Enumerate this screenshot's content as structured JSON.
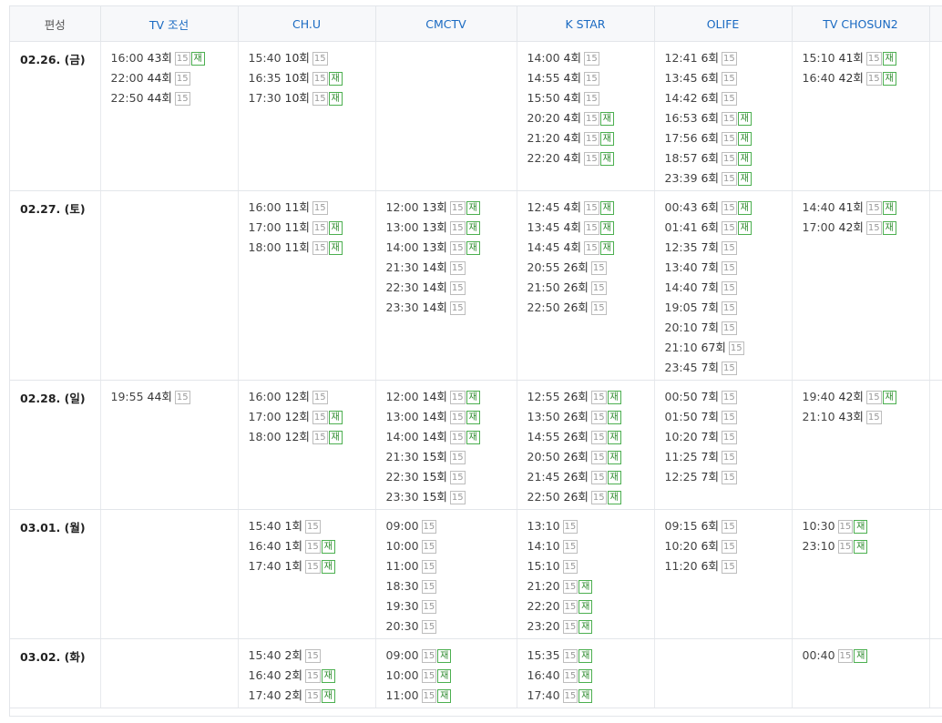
{
  "header": {
    "corner": "편성",
    "channels": [
      "TV 조선",
      "CH.U",
      "CMCTV",
      "K STAR",
      "OLIFE",
      "TV CHOSUN2"
    ]
  },
  "rows": [
    {
      "date": "02.26. (금)",
      "cells": [
        [
          {
            "t": "16:00",
            "ep": "43회",
            "g": "15",
            "re": "재"
          },
          {
            "t": "22:00",
            "ep": "44회",
            "g": "15"
          },
          {
            "t": "22:50",
            "ep": "44회",
            "g": "15"
          }
        ],
        [
          {
            "t": "15:40",
            "ep": "10회",
            "g": "15"
          },
          {
            "t": "16:35",
            "ep": "10회",
            "g": "15",
            "re": "재"
          },
          {
            "t": "17:30",
            "ep": "10회",
            "g": "15",
            "re": "재"
          }
        ],
        [],
        [
          {
            "t": "14:00",
            "ep": "4회",
            "g": "15"
          },
          {
            "t": "14:55",
            "ep": "4회",
            "g": "15"
          },
          {
            "t": "15:50",
            "ep": "4회",
            "g": "15"
          },
          {
            "t": "20:20",
            "ep": "4회",
            "g": "15",
            "re": "재"
          },
          {
            "t": "21:20",
            "ep": "4회",
            "g": "15",
            "re": "재"
          },
          {
            "t": "22:20",
            "ep": "4회",
            "g": "15",
            "re": "재"
          }
        ],
        [
          {
            "t": "12:41",
            "ep": "6회",
            "g": "15"
          },
          {
            "t": "13:45",
            "ep": "6회",
            "g": "15"
          },
          {
            "t": "14:42",
            "ep": "6회",
            "g": "15"
          },
          {
            "t": "16:53",
            "ep": "6회",
            "g": "15",
            "re": "재"
          },
          {
            "t": "17:56",
            "ep": "6회",
            "g": "15",
            "re": "재"
          },
          {
            "t": "18:57",
            "ep": "6회",
            "g": "15",
            "re": "재"
          },
          {
            "t": "23:39",
            "ep": "6회",
            "g": "15",
            "re": "재"
          }
        ],
        [
          {
            "t": "15:10",
            "ep": "41회",
            "g": "15",
            "re": "재"
          },
          {
            "t": "16:40",
            "ep": "42회",
            "g": "15",
            "re": "재"
          }
        ]
      ]
    },
    {
      "date": "02.27. (토)",
      "cells": [
        [],
        [
          {
            "t": "16:00",
            "ep": "11회",
            "g": "15"
          },
          {
            "t": "17:00",
            "ep": "11회",
            "g": "15",
            "re": "재"
          },
          {
            "t": "18:00",
            "ep": "11회",
            "g": "15",
            "re": "재"
          }
        ],
        [
          {
            "t": "12:00",
            "ep": "13회",
            "g": "15",
            "re": "재"
          },
          {
            "t": "13:00",
            "ep": "13회",
            "g": "15",
            "re": "재"
          },
          {
            "t": "14:00",
            "ep": "13회",
            "g": "15",
            "re": "재"
          },
          {
            "t": "21:30",
            "ep": "14회",
            "g": "15"
          },
          {
            "t": "22:30",
            "ep": "14회",
            "g": "15"
          },
          {
            "t": "23:30",
            "ep": "14회",
            "g": "15"
          }
        ],
        [
          {
            "t": "12:45",
            "ep": "4회",
            "g": "15",
            "re": "재"
          },
          {
            "t": "13:45",
            "ep": "4회",
            "g": "15",
            "re": "재"
          },
          {
            "t": "14:45",
            "ep": "4회",
            "g": "15",
            "re": "재"
          },
          {
            "t": "20:55",
            "ep": "26회",
            "g": "15"
          },
          {
            "t": "21:50",
            "ep": "26회",
            "g": "15"
          },
          {
            "t": "22:50",
            "ep": "26회",
            "g": "15"
          }
        ],
        [
          {
            "t": "00:43",
            "ep": "6회",
            "g": "15",
            "re": "재"
          },
          {
            "t": "01:41",
            "ep": "6회",
            "g": "15",
            "re": "재"
          },
          {
            "t": "12:35",
            "ep": "7회",
            "g": "15"
          },
          {
            "t": "13:40",
            "ep": "7회",
            "g": "15"
          },
          {
            "t": "14:40",
            "ep": "7회",
            "g": "15"
          },
          {
            "t": "19:05",
            "ep": "7회",
            "g": "15"
          },
          {
            "t": "20:10",
            "ep": "7회",
            "g": "15"
          },
          {
            "t": "21:10",
            "ep": "67회",
            "g": "15"
          },
          {
            "t": "23:45",
            "ep": "7회",
            "g": "15"
          }
        ],
        [
          {
            "t": "14:40",
            "ep": "41회",
            "g": "15",
            "re": "재"
          },
          {
            "t": "17:00",
            "ep": "42회",
            "g": "15",
            "re": "재"
          }
        ]
      ]
    },
    {
      "date": "02.28. (일)",
      "cells": [
        [
          {
            "t": "19:55",
            "ep": "44회",
            "g": "15"
          }
        ],
        [
          {
            "t": "16:00",
            "ep": "12회",
            "g": "15"
          },
          {
            "t": "17:00",
            "ep": "12회",
            "g": "15",
            "re": "재"
          },
          {
            "t": "18:00",
            "ep": "12회",
            "g": "15",
            "re": "재"
          }
        ],
        [
          {
            "t": "12:00",
            "ep": "14회",
            "g": "15",
            "re": "재"
          },
          {
            "t": "13:00",
            "ep": "14회",
            "g": "15",
            "re": "재"
          },
          {
            "t": "14:00",
            "ep": "14회",
            "g": "15",
            "re": "재"
          },
          {
            "t": "21:30",
            "ep": "15회",
            "g": "15"
          },
          {
            "t": "22:30",
            "ep": "15회",
            "g": "15"
          },
          {
            "t": "23:30",
            "ep": "15회",
            "g": "15"
          }
        ],
        [
          {
            "t": "12:55",
            "ep": "26회",
            "g": "15",
            "re": "재"
          },
          {
            "t": "13:50",
            "ep": "26회",
            "g": "15",
            "re": "재"
          },
          {
            "t": "14:55",
            "ep": "26회",
            "g": "15",
            "re": "재"
          },
          {
            "t": "20:50",
            "ep": "26회",
            "g": "15",
            "re": "재"
          },
          {
            "t": "21:45",
            "ep": "26회",
            "g": "15",
            "re": "재"
          },
          {
            "t": "22:50",
            "ep": "26회",
            "g": "15",
            "re": "재"
          }
        ],
        [
          {
            "t": "00:50",
            "ep": "7회",
            "g": "15"
          },
          {
            "t": "01:50",
            "ep": "7회",
            "g": "15"
          },
          {
            "t": "10:20",
            "ep": "7회",
            "g": "15"
          },
          {
            "t": "11:25",
            "ep": "7회",
            "g": "15"
          },
          {
            "t": "12:25",
            "ep": "7회",
            "g": "15"
          }
        ],
        [
          {
            "t": "19:40",
            "ep": "42회",
            "g": "15",
            "re": "재"
          },
          {
            "t": "21:10",
            "ep": "43회",
            "g": "15"
          }
        ]
      ]
    },
    {
      "date": "03.01. (월)",
      "cells": [
        [],
        [
          {
            "t": "15:40",
            "ep": "1회",
            "g": "15"
          },
          {
            "t": "16:40",
            "ep": "1회",
            "g": "15",
            "re": "재"
          },
          {
            "t": "17:40",
            "ep": "1회",
            "g": "15",
            "re": "재"
          }
        ],
        [
          {
            "t": "09:00",
            "ep": "",
            "g": "15"
          },
          {
            "t": "10:00",
            "ep": "",
            "g": "15"
          },
          {
            "t": "11:00",
            "ep": "",
            "g": "15"
          },
          {
            "t": "18:30",
            "ep": "",
            "g": "15"
          },
          {
            "t": "19:30",
            "ep": "",
            "g": "15"
          },
          {
            "t": "20:30",
            "ep": "",
            "g": "15"
          }
        ],
        [
          {
            "t": "13:10",
            "ep": "",
            "g": "15"
          },
          {
            "t": "14:10",
            "ep": "",
            "g": "15"
          },
          {
            "t": "15:10",
            "ep": "",
            "g": "15"
          },
          {
            "t": "21:20",
            "ep": "",
            "g": "15",
            "re": "재"
          },
          {
            "t": "22:20",
            "ep": "",
            "g": "15",
            "re": "재"
          },
          {
            "t": "23:20",
            "ep": "",
            "g": "15",
            "re": "재"
          }
        ],
        [
          {
            "t": "09:15",
            "ep": "6회",
            "g": "15"
          },
          {
            "t": "10:20",
            "ep": "6회",
            "g": "15"
          },
          {
            "t": "11:20",
            "ep": "6회",
            "g": "15"
          }
        ],
        [
          {
            "t": "10:30",
            "ep": "",
            "g": "15",
            "re": "재"
          },
          {
            "t": "23:10",
            "ep": "",
            "g": "15",
            "re": "재"
          }
        ]
      ]
    },
    {
      "date": "03.02. (화)",
      "cells": [
        [],
        [
          {
            "t": "15:40",
            "ep": "2회",
            "g": "15"
          },
          {
            "t": "16:40",
            "ep": "2회",
            "g": "15",
            "re": "재"
          },
          {
            "t": "17:40",
            "ep": "2회",
            "g": "15",
            "re": "재"
          }
        ],
        [
          {
            "t": "09:00",
            "ep": "",
            "g": "15",
            "re": "재"
          },
          {
            "t": "10:00",
            "ep": "",
            "g": "15",
            "re": "재"
          },
          {
            "t": "11:00",
            "ep": "",
            "g": "15",
            "re": "재"
          }
        ],
        [
          {
            "t": "15:35",
            "ep": "",
            "g": "15",
            "re": "재"
          },
          {
            "t": "16:40",
            "ep": "",
            "g": "15",
            "re": "재"
          },
          {
            "t": "17:40",
            "ep": "",
            "g": "15",
            "re": "재"
          }
        ],
        [],
        [
          {
            "t": "00:40",
            "ep": "",
            "g": "15",
            "re": "재"
          }
        ]
      ]
    }
  ]
}
